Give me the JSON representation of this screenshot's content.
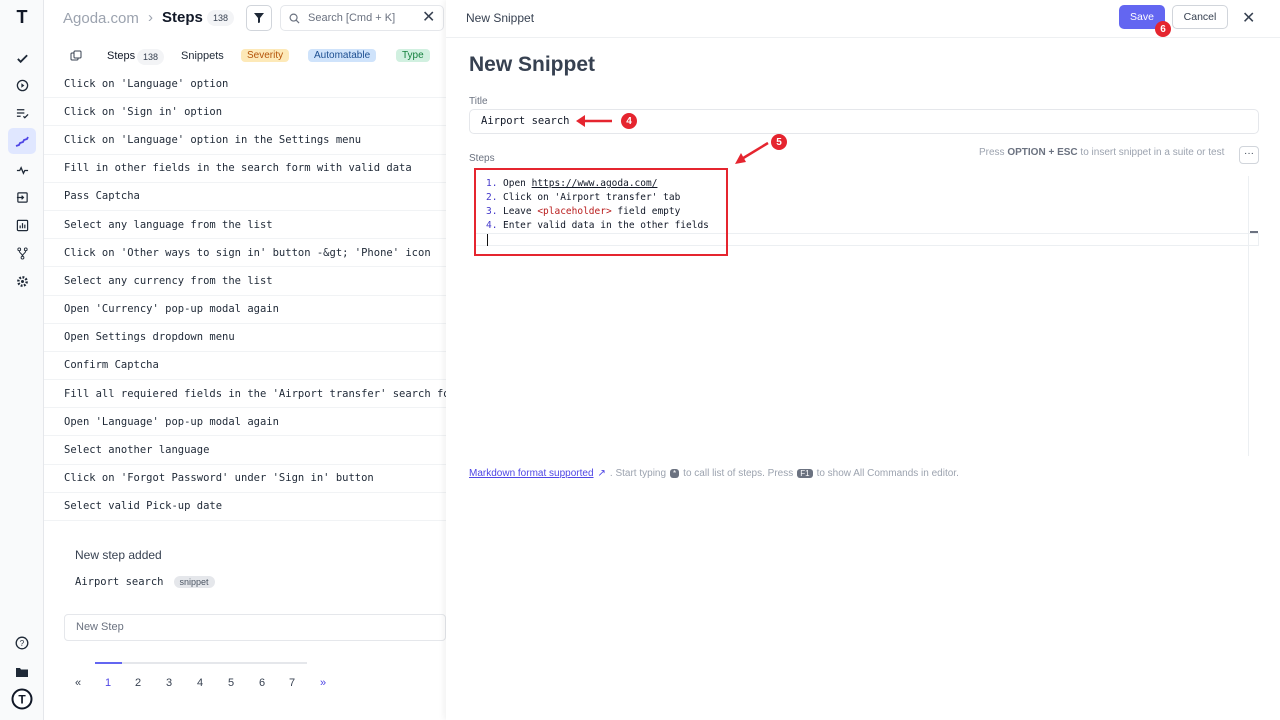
{
  "rail": {
    "logo": "T",
    "icons": [
      "check-icon",
      "play-circle-icon",
      "list-check-icon",
      "stairs-icon",
      "pulse-icon",
      "import-icon",
      "chart-icon",
      "branch-icon",
      "gear-icon",
      "help-icon",
      "folder-icon",
      "avatar-icon"
    ]
  },
  "header": {
    "project": "Agoda.com",
    "separator": "›",
    "section": "Steps",
    "count": "138",
    "search_placeholder": "Search [Cmd + K]",
    "close": "✕"
  },
  "tabs": {
    "steps_label": "Steps",
    "steps_count": "138",
    "snippets_label": "Snippets",
    "severity": "Severity",
    "automatable": "Automatable",
    "type": "Type"
  },
  "steps": [
    "Click on 'Language' option",
    "Click on 'Sign in' option",
    "Click on 'Language' option in the Settings menu",
    "Fill in other fields in the search form with valid data",
    "Pass Captcha",
    "Select any language from the list",
    "Click on 'Other ways to sign in' button -&gt; 'Phone' icon",
    "Select any currency from the list",
    "Open 'Currency' pop-up modal again",
    "Open Settings dropdown menu",
    "Confirm Captcha",
    "Fill all requiered fields in the 'Airport transfer' search form w",
    "Open 'Language' pop-up modal again",
    "Select another language",
    "Click on 'Forgot Password' under 'Sign in' button",
    "Select valid Pick-up date"
  ],
  "added": {
    "heading": "New step added",
    "item": "Airport search",
    "badge": "snippet"
  },
  "new_step_placeholder": "New Step",
  "pager": {
    "prev": "«",
    "pages": [
      "1",
      "2",
      "3",
      "4",
      "5",
      "6",
      "7"
    ],
    "next": "»"
  },
  "snippet": {
    "top_title": "New Snippet",
    "save": "Save",
    "cancel": "Cancel",
    "close": "✕",
    "heading": "New Snippet",
    "title_label": "Title",
    "title_value": "Airport search",
    "steps_label": "Steps",
    "hint_pre": "Press",
    "hint_keys": "OPTION + ESC",
    "hint_post": "to insert snippet in a suite or test",
    "more": "···",
    "lines": [
      {
        "num": "1.",
        "pre": "Open ",
        "link": "https://www.agoda.com/",
        "ph": "",
        "post": ""
      },
      {
        "num": "2.",
        "pre": "Click on 'Airport transfer' tab",
        "link": "",
        "ph": "",
        "post": ""
      },
      {
        "num": "3.",
        "pre": "Leave ",
        "link": "",
        "ph": "<placeholder>",
        "post": " field empty"
      },
      {
        "num": "4.",
        "pre": "Enter valid data in the other fields",
        "link": "",
        "ph": "",
        "post": ""
      }
    ],
    "md_link": "Markdown format supported",
    "md_arrow": "↗",
    "md_text1": ". Start typing",
    "md_key1": "*",
    "md_text2": "to call list of steps. Press",
    "md_key2": "F1",
    "md_text3": "to show All Commands in editor."
  },
  "annotations": {
    "m4": "4",
    "m5": "5",
    "m6": "6",
    "color": "#e5252f"
  }
}
